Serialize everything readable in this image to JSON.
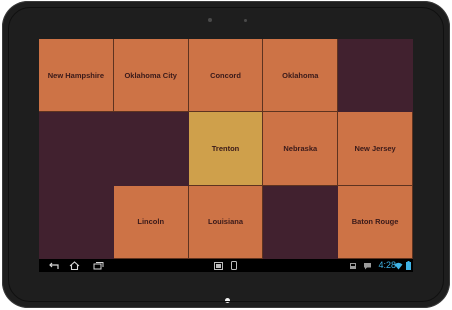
{
  "grid": {
    "cells": [
      {
        "label": "New Hampshire",
        "state": "orange"
      },
      {
        "label": "Oklahoma City",
        "state": "orange"
      },
      {
        "label": "Concord",
        "state": "orange"
      },
      {
        "label": "Oklahoma",
        "state": "orange"
      },
      {
        "label": "",
        "state": "empty"
      },
      {
        "label": "",
        "state": "empty"
      },
      {
        "label": "",
        "state": "empty"
      },
      {
        "label": "Trenton",
        "state": "gold"
      },
      {
        "label": "Nebraska",
        "state": "orange"
      },
      {
        "label": "New Jersey",
        "state": "orange"
      },
      {
        "label": "",
        "state": "empty"
      },
      {
        "label": "Lincoln",
        "state": "orange"
      },
      {
        "label": "Louisiana",
        "state": "orange"
      },
      {
        "label": "",
        "state": "empty"
      },
      {
        "label": "Baton Rouge",
        "state": "orange"
      }
    ]
  },
  "colors": {
    "tile": "#cd7346",
    "selected_tile": "#cfa04b",
    "background": "#41212f",
    "clock": "#3fb3e6"
  },
  "navbar": {
    "icons": [
      "back-icon",
      "home-icon",
      "recent-apps-icon",
      "screenshot-icon",
      "phone-icon",
      "storage-icon",
      "chat-icon",
      "wifi-icon",
      "battery-icon"
    ]
  },
  "status": {
    "time": "4:28"
  }
}
